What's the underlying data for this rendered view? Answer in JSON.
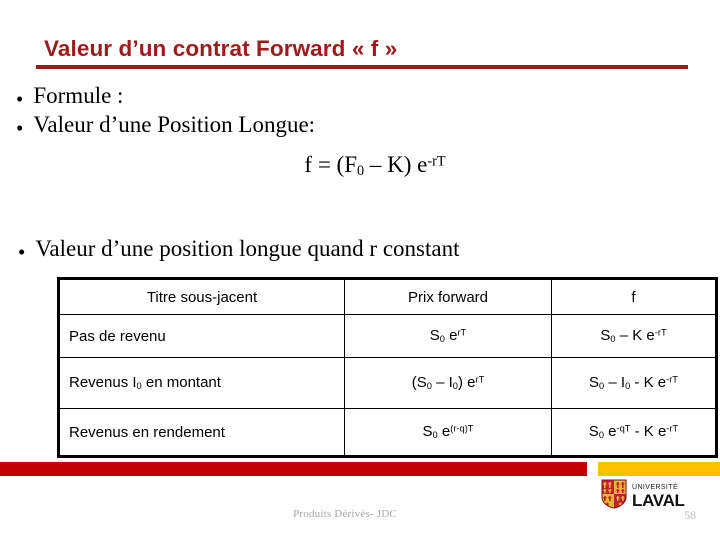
{
  "slide": {
    "title": "Valeur d’un contrat Forward « f »",
    "bullet_char": "•"
  },
  "bullets": {
    "formule": "Formule :",
    "position_longue": "Valeur d’une Position Longue:",
    "position_constante": "Valeur d’une position longue quand r constant"
  },
  "formula": {
    "lead": "f = (F",
    "sub_zero": "0",
    "middle": " – K) e",
    "exponent": "-rT"
  },
  "table": {
    "headers": [
      "Titre sous-jacent",
      "Prix forward",
      "f"
    ],
    "rows": [
      {
        "label": "Pas de revenu",
        "forward": {
          "base1": "S",
          "sub1": "0",
          "mid1": " e",
          "exp1": "rT"
        },
        "f": {
          "base1": "S",
          "sub1": "0",
          "mid1": " – K e",
          "exp1": "-rT"
        }
      },
      {
        "label_a": "Revenus I",
        "label_sub": "0",
        "label_b": " en montant",
        "forward": {
          "base1": "(S",
          "sub1": "0",
          "mid1": " – I",
          "sub2": "0",
          "mid2": ") e",
          "exp1": "rT"
        },
        "f": {
          "base1": "S",
          "sub1": "0",
          "mid1": " – I",
          "sub2": "0",
          "mid2": " - K e",
          "exp1": "-rT"
        }
      },
      {
        "label": "Revenus en rendement",
        "forward": {
          "base1": "S",
          "sub1": "0",
          "mid1": " e",
          "exp1": "(r-q)T"
        },
        "f": {
          "base1": "S",
          "sub1": "0",
          "mid1": " e",
          "exp1": "-qT",
          "mid2": " - K e",
          "exp2": "-rT"
        }
      }
    ]
  },
  "footer": {
    "center_text": "Produits Dérivés- JDC",
    "page_number": "58",
    "logo_superline": "UNIVERSITÉ",
    "logo_name": "LAVAL"
  },
  "colors": {
    "title_red": "#9E1B1B",
    "bar_red": "#C00000",
    "bar_gold": "#FFC000",
    "footer_gray": "#a6a6a6",
    "page_gray": "#bdbdbd",
    "shield_red": "#C1232B",
    "shield_gold": "#E8B53A"
  }
}
